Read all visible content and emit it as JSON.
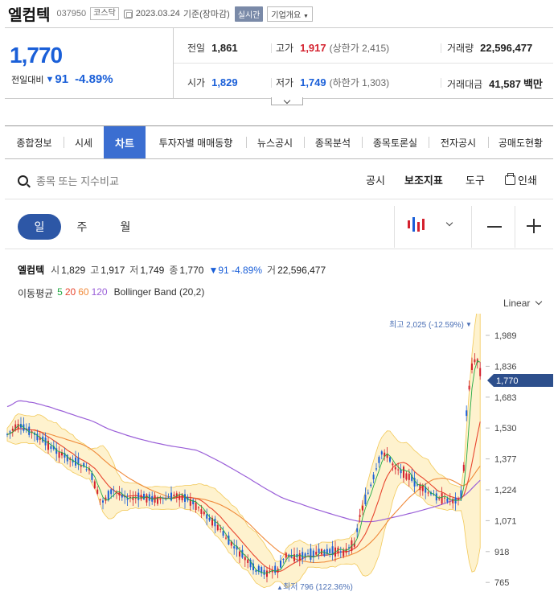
{
  "header": {
    "name": "엘컴텍",
    "code": "037950",
    "market": "코스닥",
    "date": "2023.03.24",
    "basis": "기준(장마감)",
    "realtime": "실시간",
    "company_info": "기업개요"
  },
  "price": {
    "current": "1,770",
    "change_label": "전일대비",
    "change_symbol": "▼",
    "change": "91",
    "change_pct": "-4.89%",
    "prev_close_label": "전일",
    "prev_close": "1,861",
    "high_label": "고가",
    "high": "1,917",
    "upper_limit": "(상한가 2,415)",
    "volume_label": "거래량",
    "volume": "22,596,477",
    "open_label": "시가",
    "open": "1,829",
    "low_label": "저가",
    "low": "1,749",
    "lower_limit": "(하한가 1,303)",
    "amount_label": "거래대금",
    "amount": "41,587",
    "amount_unit": "백만"
  },
  "tabs": [
    "종합정보",
    "시세",
    "차트",
    "투자자별 매매동향",
    "뉴스공시",
    "종목분석",
    "종목토론실",
    "전자공시",
    "공매도현황"
  ],
  "active_tab": 2,
  "toolbar": {
    "search_placeholder": "종목 또는 지수비교",
    "notice": "공시",
    "indicators": "보조지표",
    "tools": "도구",
    "print": "인쇄"
  },
  "periods": [
    "일",
    "주",
    "월"
  ],
  "active_period": 0,
  "summary": {
    "name": "엘컴텍",
    "open_k": "시",
    "open": "1,829",
    "high_k": "고",
    "high": "1,917",
    "low_k": "저",
    "low": "1,749",
    "close_k": "종",
    "close": "1,770",
    "change": "▼91 -4.89%",
    "vol_k": "거",
    "volume": "22,596,477"
  },
  "indicators": {
    "ma_label": "이동평균",
    "ma": [
      "5",
      "20",
      "60",
      "120"
    ],
    "bollinger": "Bollinger Band (20,2)"
  },
  "colors": {
    "up": "#d4212e",
    "down": "#1a5fd8",
    "ma5": "#22aa44",
    "ma20": "#e8452e",
    "ma60": "#f08a3a",
    "ma120": "#9a5fd8",
    "band": "#fde7a6"
  },
  "scale_label": "Linear",
  "chart_data": {
    "type": "line",
    "price_axis": [
      "1,989",
      "1,836",
      "1,683",
      "1,530",
      "1,377",
      "1,224",
      "1,071",
      "918",
      "765"
    ],
    "current_tag": "1,770",
    "max_label": "최고 2,025 (-12.59%)",
    "min_label": "최저 796 (122.36%)"
  }
}
